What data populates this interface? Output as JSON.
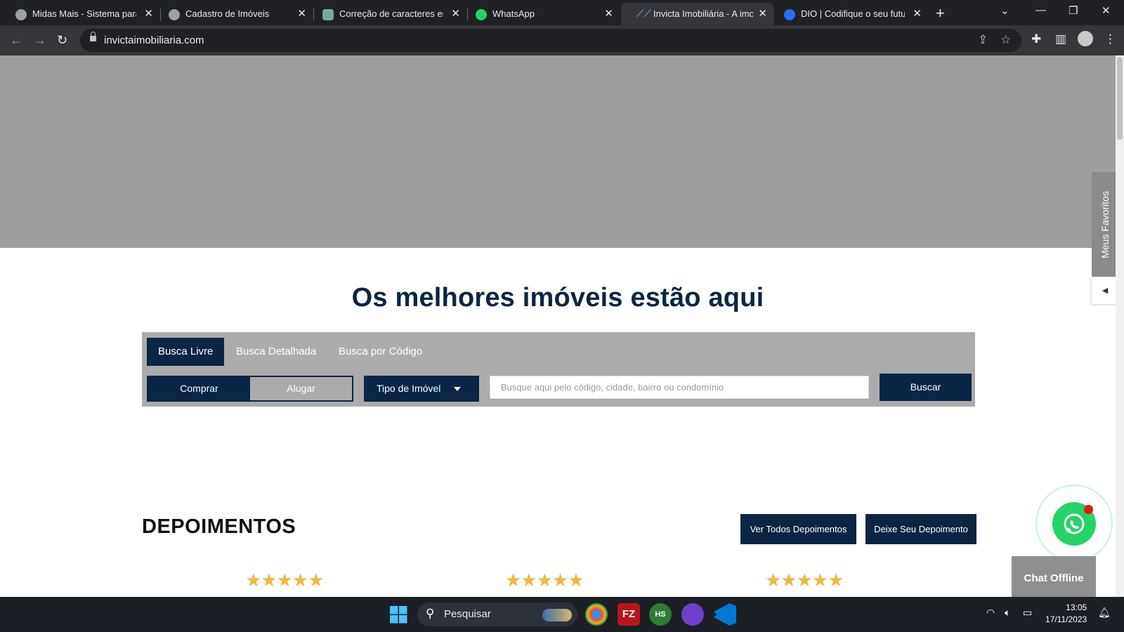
{
  "browser": {
    "tabs": [
      {
        "title": "Midas Mais - Sistema para",
        "icon": "globe-icon"
      },
      {
        "title": "Cadastro de Imóveis",
        "icon": "globe-icon"
      },
      {
        "title": "Correção de caracteres esp",
        "icon": "chatgpt-icon"
      },
      {
        "title": "WhatsApp",
        "icon": "whatsapp-icon"
      },
      {
        "title": "Invicta Imobiliária - A imob",
        "icon": "invicta-icon",
        "active": true
      },
      {
        "title": "DIO | Codifique o seu futur",
        "icon": "dio-icon"
      }
    ],
    "url": "invictaimobiliaria.com"
  },
  "page": {
    "headline": "Os melhores imóveis estão aqui",
    "search": {
      "tabs": [
        "Busca Livre",
        "Busca Detalhada",
        "Busca por Código"
      ],
      "active_tab": "Busca Livre",
      "toggle": {
        "comprar": "Comprar",
        "alugar": "Alugar",
        "selected": "Comprar"
      },
      "tipo": "Tipo de Imóvel",
      "placeholder": "Busque aqui pelo código, cidade, bairro ou condomínio",
      "button": "Buscar"
    },
    "depoimentos": {
      "title": "DEPOIMENTOS",
      "ver_todos": "Ver Todos Depoimentos",
      "deixe": "Deixe Seu Depoimento",
      "stars": "★★★★★"
    },
    "favoritos": "Meus Favoritos",
    "chat": "Chat Offline"
  },
  "taskbar": {
    "search": "Pesquisar",
    "time": "13:05",
    "date": "17/11/2023"
  },
  "colors": {
    "brand": "#0b2545",
    "hero": "#9e9e9e",
    "star": "#f2b73b",
    "whatsapp": "#25d366"
  }
}
